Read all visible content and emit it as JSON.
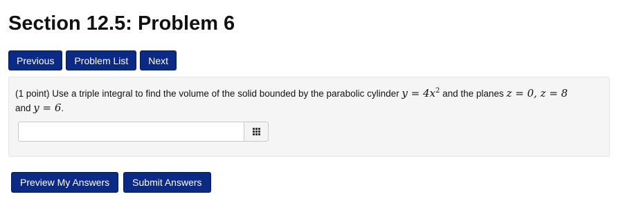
{
  "page": {
    "title": "Section 12.5: Problem 6"
  },
  "nav": {
    "previous_label": "Previous",
    "problem_list_label": "Problem List",
    "next_label": "Next"
  },
  "problem": {
    "points": "(1 point)",
    "text_before": "Use a triple integral to find the volume of the solid bounded by the parabolic cylinder",
    "eq_cylinder": "y = 4x",
    "eq_cylinder_exp": "2",
    "text_middle": "and the planes",
    "eq_planes": "z = 0, z = 8",
    "text_and": "and",
    "eq_y": "y = 6",
    "period": "."
  },
  "answer": {
    "value": "",
    "palette_icon": "grid-icon"
  },
  "actions": {
    "preview_label": "Preview My Answers",
    "submit_label": "Submit Answers"
  },
  "colors": {
    "button_bg": "#0a2a85",
    "panel_bg": "#f5f5f5"
  }
}
